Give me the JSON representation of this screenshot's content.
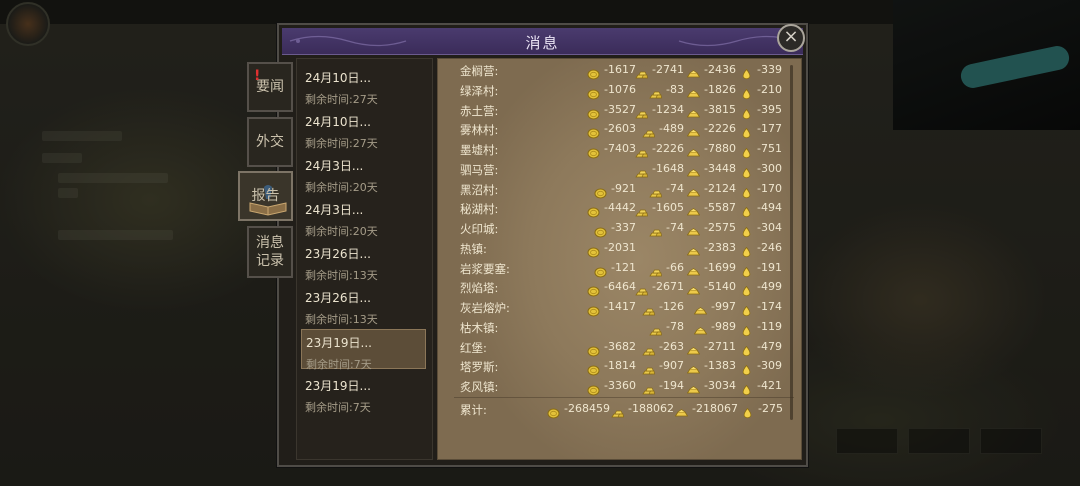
{
  "dialog": {
    "title": "消息",
    "close_label": "×"
  },
  "tabs": [
    {
      "label": "要闻",
      "alert": "!"
    },
    {
      "label": "外交"
    },
    {
      "label": "报告"
    },
    {
      "label": "消息记录"
    }
  ],
  "messages": [
    {
      "date": "24月10日...",
      "remaining": "剩余时间:27天"
    },
    {
      "date": "24月10日...",
      "remaining": "剩余时间:27天"
    },
    {
      "date": "24月3日...",
      "remaining": "剩余时间:20天"
    },
    {
      "date": "24月3日...",
      "remaining": "剩余时间:20天"
    },
    {
      "date": "23月26日...",
      "remaining": "剩余时间:13天"
    },
    {
      "date": "23月26日...",
      "remaining": "剩余时间:13天"
    },
    {
      "date": "23月19日...",
      "remaining": "剩余时间:7天"
    },
    {
      "date": "23月19日...",
      "remaining": "剩余时间:7天"
    }
  ],
  "report": {
    "rows": [
      {
        "name": "金榈营:",
        "gold": "-1617",
        "bars": "-2741",
        "ingot": "-2436",
        "drop": "-339"
      },
      {
        "name": "绿泽村:",
        "gold": "-1076",
        "bars": "-83",
        "ingot": "-1826",
        "drop": "-210"
      },
      {
        "name": "赤土营:",
        "gold": "-3527",
        "bars": "-1234",
        "ingot": "-3815",
        "drop": "-395"
      },
      {
        "name": "雾林村:",
        "gold": "-2603",
        "bars": "-489",
        "ingot": "-2226",
        "drop": "-177"
      },
      {
        "name": "墨墟村:",
        "gold": "-7403",
        "bars": "-2226",
        "ingot": "-7880",
        "drop": "-751"
      },
      {
        "name": "驷马营:",
        "gold": "",
        "bars": "-1648",
        "ingot": "-3448",
        "drop": "-300"
      },
      {
        "name": "黑沼村:",
        "gold": "-921",
        "bars": "-74",
        "ingot": "-2124",
        "drop": "-170"
      },
      {
        "name": "秘湖村:",
        "gold": "-4442",
        "bars": "-1605",
        "ingot": "-5587",
        "drop": "-494"
      },
      {
        "name": "火印城:",
        "gold": "-337",
        "bars": "-74",
        "ingot": "-2575",
        "drop": "-304"
      },
      {
        "name": "热镇:",
        "gold": "-2031",
        "bars": "",
        "ingot": "-2383",
        "drop": "-246"
      },
      {
        "name": "岩浆要塞:",
        "gold": "-121",
        "bars": "-66",
        "ingot": "-1699",
        "drop": "-191"
      },
      {
        "name": "烈焰塔:",
        "gold": "-6464",
        "bars": "-2671",
        "ingot": "-5140",
        "drop": "-499"
      },
      {
        "name": "灰岩熔炉:",
        "gold": "-1417",
        "bars": "-126",
        "ingot": "-997",
        "drop": "-174"
      },
      {
        "name": "枯木镇:",
        "gold": "",
        "bars": "-78",
        "ingot": "-989",
        "drop": "-119"
      },
      {
        "name": "红堡:",
        "gold": "-3682",
        "bars": "-263",
        "ingot": "-2711",
        "drop": "-479"
      },
      {
        "name": "塔罗斯:",
        "gold": "-1814",
        "bars": "-907",
        "ingot": "-1383",
        "drop": "-309"
      },
      {
        "name": "炙风镇:",
        "gold": "-3360",
        "bars": "-194",
        "ingot": "-3034",
        "drop": "-421"
      }
    ],
    "total": {
      "name": "累计:",
      "gold": "-268459",
      "bars": "-188062",
      "ingot": "-218067",
      "drop": "-275"
    }
  },
  "icons": [
    "gold-coin-icon",
    "gold-bars-icon",
    "gold-ingot-icon",
    "gold-drop-icon",
    "book-icon",
    "close-icon"
  ],
  "colors": {
    "title_bar": "#3b2c5a",
    "parchment": "#8d795b",
    "selected_item": "#5c4d38",
    "alert": "#e23030",
    "coin": "#e3c23a"
  }
}
